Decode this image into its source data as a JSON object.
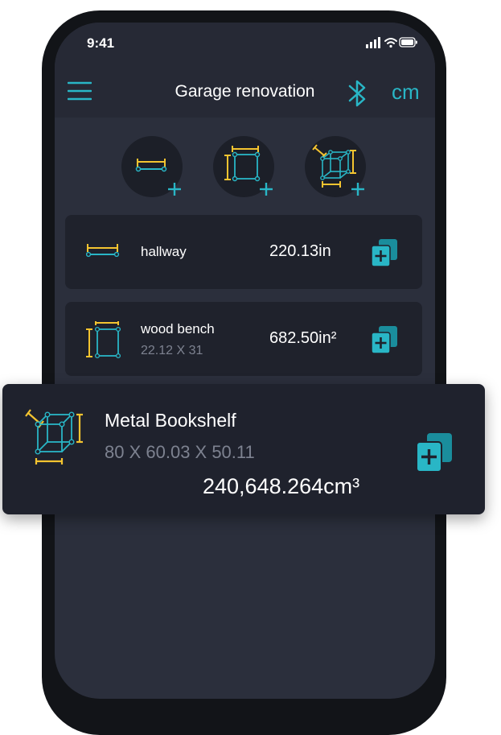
{
  "status": {
    "time": "9:41"
  },
  "header": {
    "title": "Garage renovation",
    "unit": "cm",
    "menu_icon": "hamburger-menu-icon",
    "bluetooth_icon": "bluetooth-icon"
  },
  "quick_add": [
    {
      "icon": "add-line-measurement-icon"
    },
    {
      "icon": "add-area-measurement-icon"
    },
    {
      "icon": "add-volume-measurement-icon"
    }
  ],
  "items": [
    {
      "icon": "line-measure-icon",
      "name": "hallway",
      "dims": "",
      "value": "220.13in",
      "action_icon": "duplicate-add-icon"
    },
    {
      "icon": "area-measure-icon",
      "name": "wood bench",
      "dims": "22.12 X 31",
      "value": "682.50in²",
      "action_icon": "duplicate-add-icon"
    }
  ],
  "dragged_item": {
    "icon": "volume-measure-icon",
    "name": "Metal Bookshelf",
    "dims": "80 X 60.03 X 50.11",
    "value": "240,648.264cm³",
    "action_icon": "duplicate-add-icon"
  },
  "colors": {
    "accent": "#29b6c6",
    "measure_yellow": "#f4c430",
    "background": "#2b2f3c",
    "card": "#1f222c"
  }
}
